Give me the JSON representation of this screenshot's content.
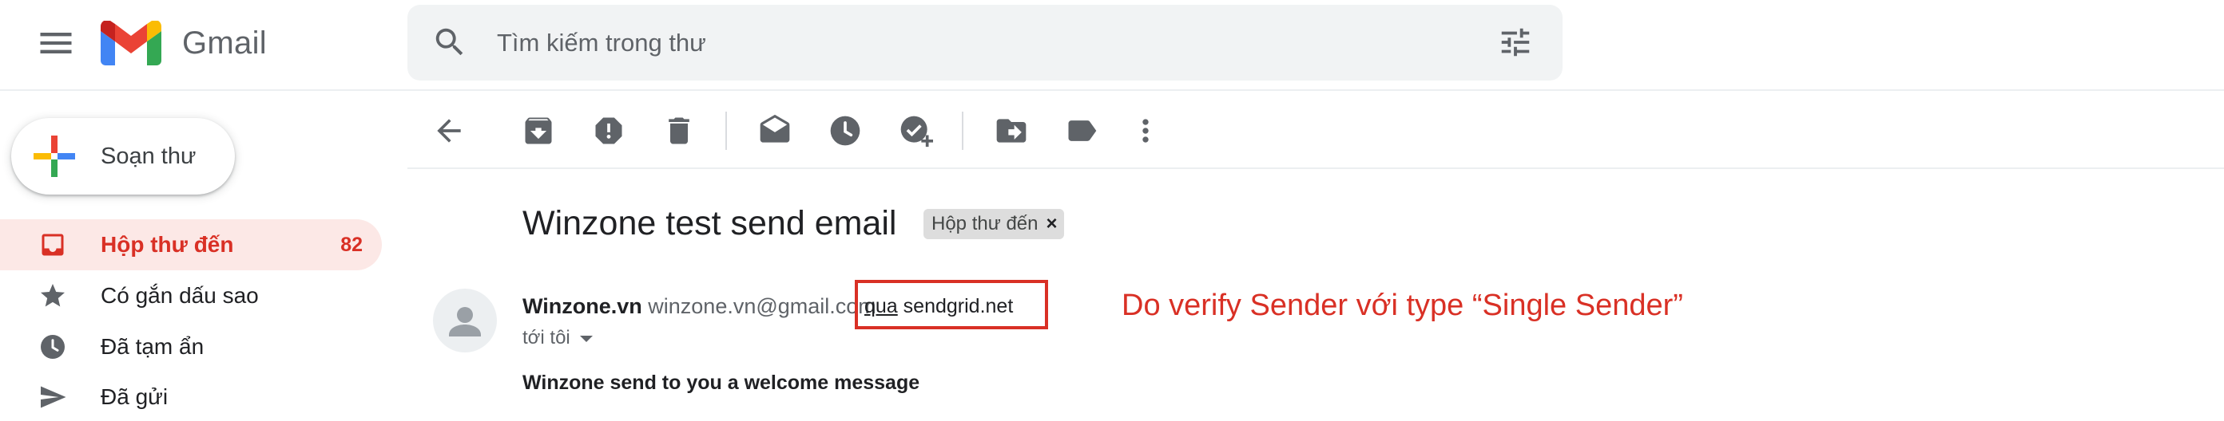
{
  "app": {
    "brand": "Gmail"
  },
  "search": {
    "placeholder": "Tìm kiếm trong thư"
  },
  "compose": {
    "label": "Soạn thư"
  },
  "sidebar": {
    "items": [
      {
        "label": "Hộp thư đến",
        "count": "82",
        "icon": "inbox-icon",
        "active": true
      },
      {
        "label": "Có gắn dấu sao",
        "icon": "star-icon"
      },
      {
        "label": "Đã tạm ẩn",
        "icon": "clock-icon"
      },
      {
        "label": "Đã gửi",
        "icon": "send-icon"
      }
    ]
  },
  "toolbar": {
    "icons": [
      "back-arrow-icon",
      "archive-icon",
      "report-spam-icon",
      "delete-icon",
      "mark-unread-icon",
      "snooze-icon",
      "add-to-tasks-icon",
      "move-to-icon",
      "label-icon",
      "more-icon"
    ]
  },
  "message": {
    "subject": "Winzone test send email",
    "label_chip": "Hộp thư đến",
    "label_chip_close": "×",
    "sender_name": "Winzone.vn",
    "sender_email": "winzone.vn@gmail.com",
    "via_word": "qua",
    "via_domain": "sendgrid.net",
    "to": "tới tôi",
    "body": "Winzone send to you a welcome message"
  },
  "annotation": {
    "text": "Do verify Sender với type “Single Sender”",
    "color": "#d93025"
  },
  "colors": {
    "accent_red": "#d93025",
    "active_bg": "#fce8e6",
    "icon_gray": "#5f6368"
  }
}
